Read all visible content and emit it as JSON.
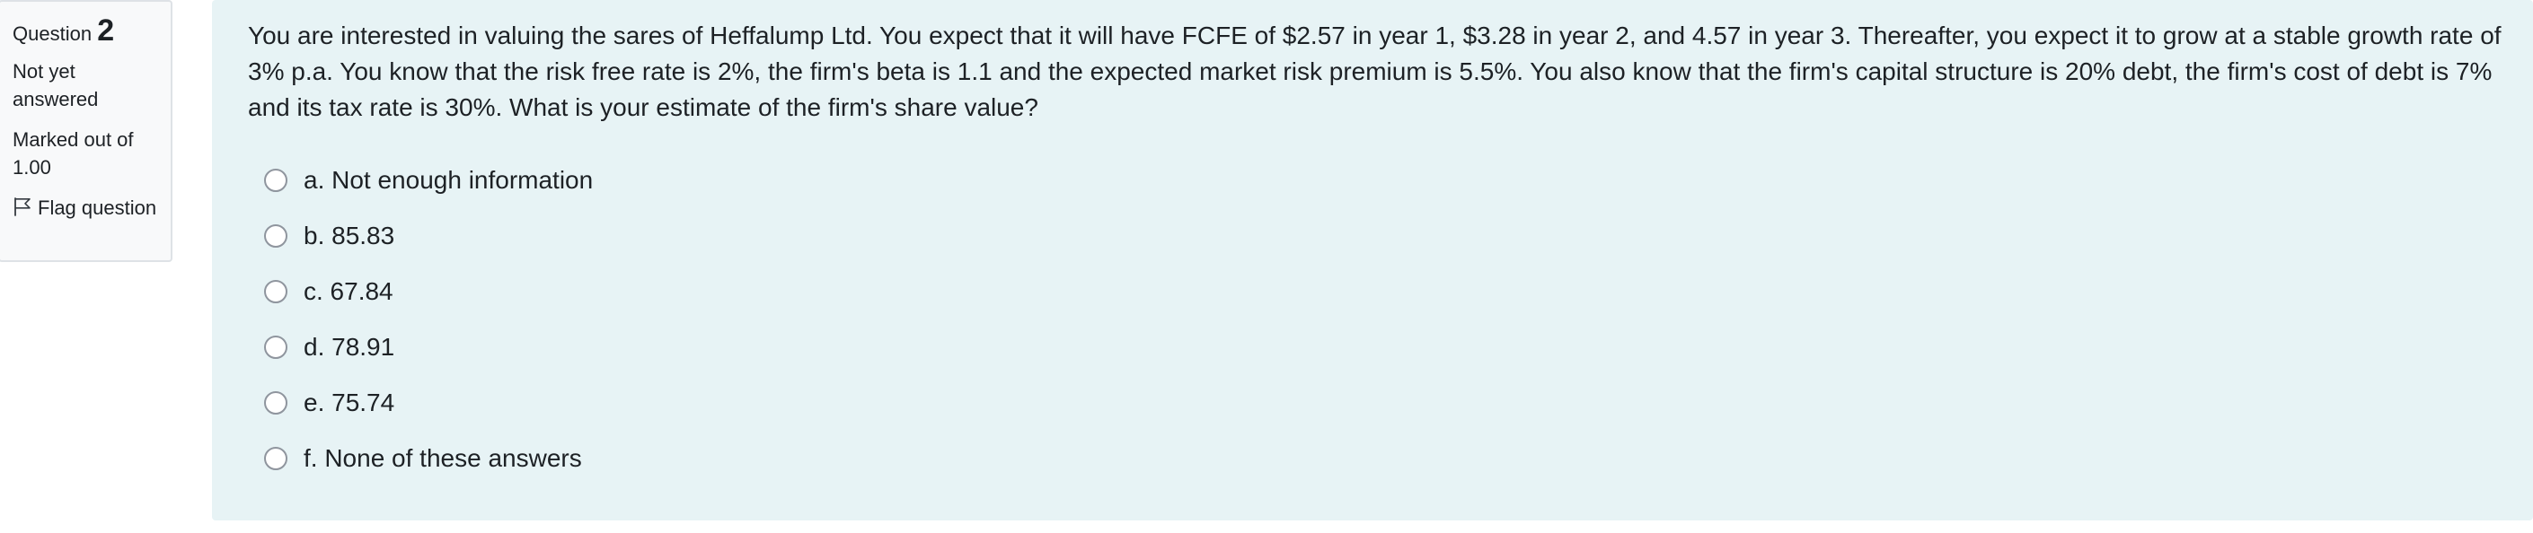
{
  "info": {
    "question_word": "Question",
    "question_number": "2",
    "state": "Not yet answered",
    "grade": "Marked out of 1.00",
    "flag_label": "Flag question",
    "flag_icon": "flag-outline-icon"
  },
  "question": {
    "text": "You are interested in valuing the sares of Heffalump Ltd. You expect that it will have FCFE of $2.57 in year 1, $3.28 in year 2, and 4.57 in year 3. Thereafter, you expect it to grow at a stable growth rate of 3% p.a. You know that the risk free rate is 2%, the firm's beta is 1.1 and the expected market risk premium is 5.5%. You also know that the firm's capital structure is 20% debt, the firm's cost of debt is 7% and its tax rate is 30%. What is your estimate of the firm's share value?",
    "answers": [
      {
        "label": "a. Not enough information",
        "selected": false
      },
      {
        "label": "b. 85.83",
        "selected": false
      },
      {
        "label": "c. 67.84",
        "selected": false
      },
      {
        "label": "d. 78.91",
        "selected": false
      },
      {
        "label": "e. 75.74",
        "selected": false
      },
      {
        "label": "f. None of these answers",
        "selected": false
      }
    ]
  },
  "colors": {
    "info_background": "#f8f9fa",
    "content_background": "#e7f3f5",
    "text": "#1d2125",
    "radio_border": "#8f959e"
  }
}
